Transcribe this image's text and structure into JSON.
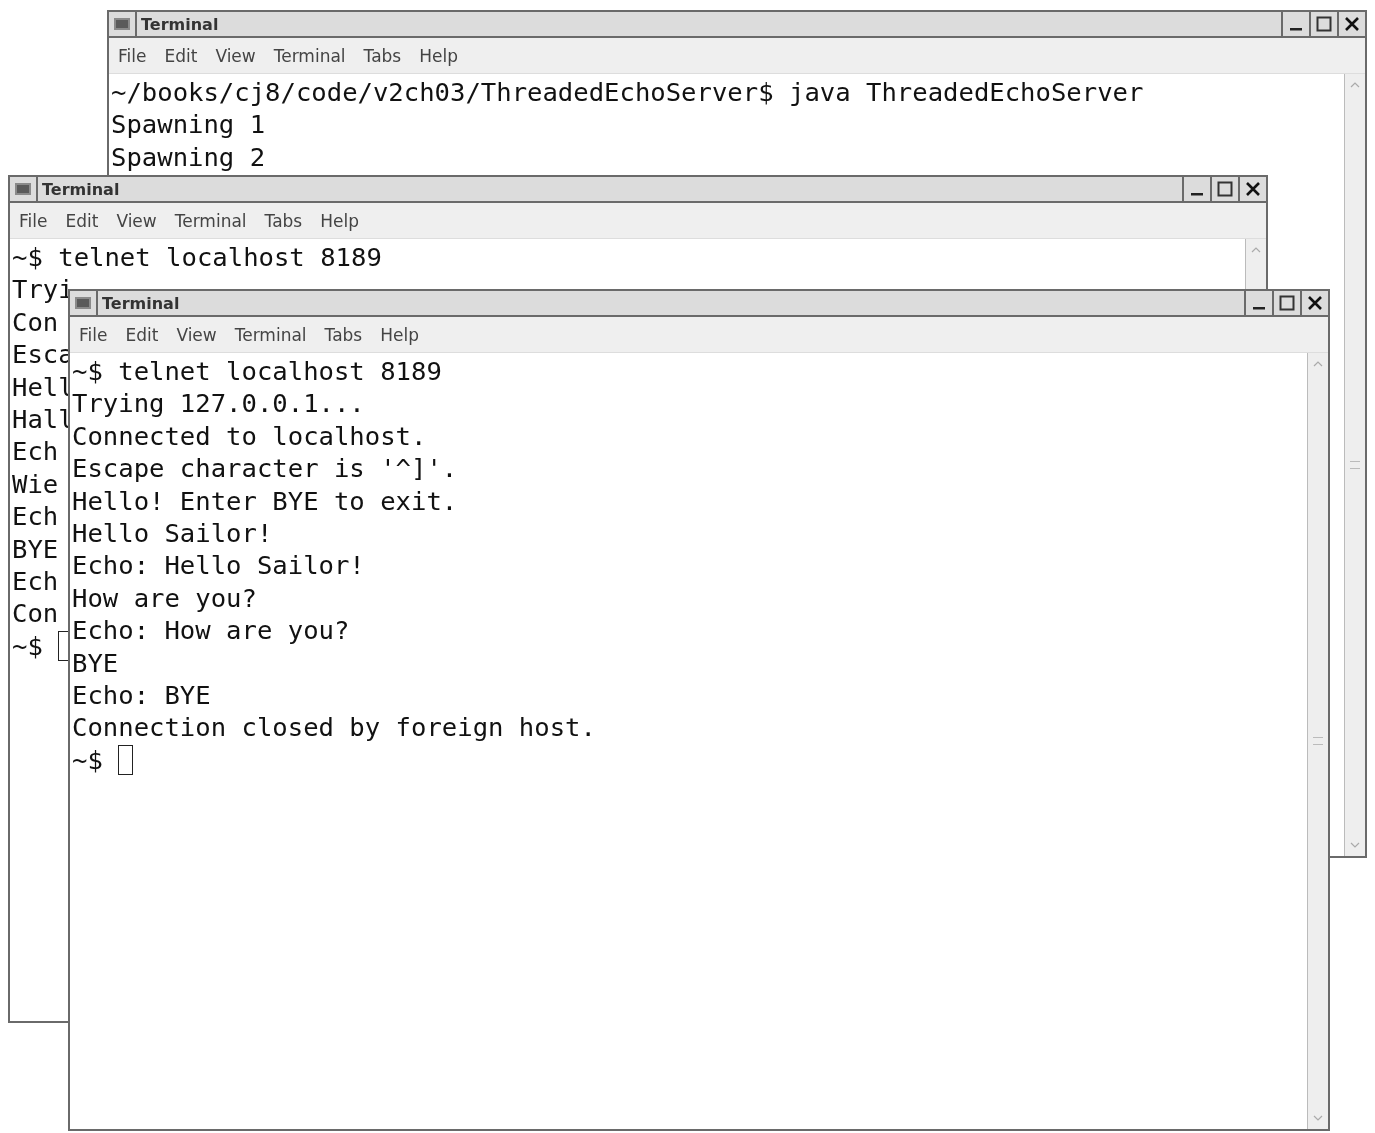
{
  "windows": [
    {
      "title": "Terminal",
      "menu": [
        "File",
        "Edit",
        "View",
        "Terminal",
        "Tabs",
        "Help"
      ],
      "lines": [
        "~/books/cj8/code/v2ch03/ThreadedEchoServer$ java ThreadedEchoServer",
        "Spawning 1",
        "Spawning 2"
      ],
      "cursor": false
    },
    {
      "title": "Terminal",
      "menu": [
        "File",
        "Edit",
        "View",
        "Terminal",
        "Tabs",
        "Help"
      ],
      "lines": [
        "~$ telnet localhost 8189",
        "Tryi",
        "Con",
        "Esca",
        "Hell",
        "Hall",
        "Ech",
        "Wie",
        "Ech",
        "BYE",
        "Ech",
        "Con",
        "~$"
      ],
      "cursor": true
    },
    {
      "title": "Terminal",
      "menu": [
        "File",
        "Edit",
        "View",
        "Terminal",
        "Tabs",
        "Help"
      ],
      "lines": [
        "~$ telnet localhost 8189",
        "Trying 127.0.0.1...",
        "Connected to localhost.",
        "Escape character is '^]'.",
        "Hello! Enter BYE to exit.",
        "Hello Sailor!",
        "Echo: Hello Sailor!",
        "How are you?",
        "Echo: How are you?",
        "BYE",
        "Echo: BYE",
        "Connection closed by foreign host.",
        "~$"
      ],
      "cursor": true
    }
  ]
}
